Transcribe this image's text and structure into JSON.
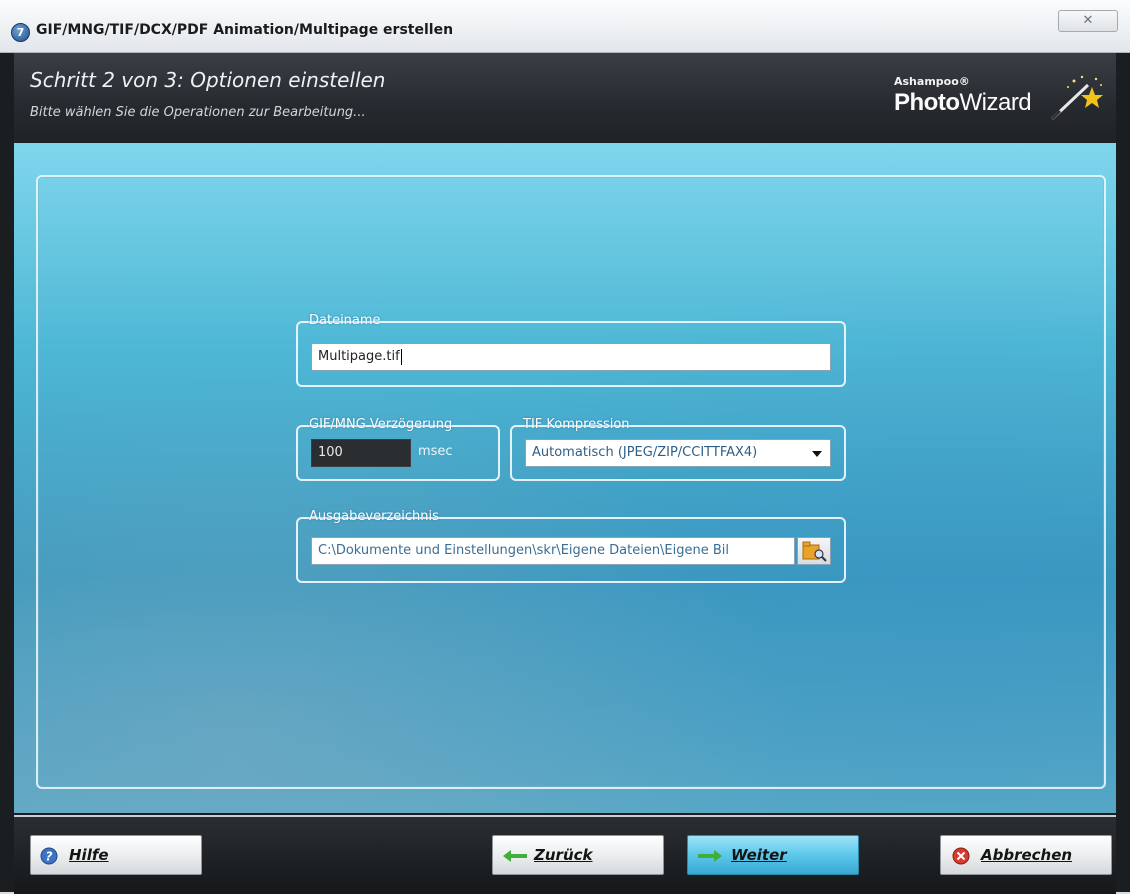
{
  "window": {
    "title": "GIF/MNG/TIF/DCX/PDF Animation/Multipage erstellen",
    "app_icon_glyph": "7",
    "close_label": "✕"
  },
  "header": {
    "step_title": "Schritt 2 von 3: Optionen einstellen",
    "step_subtitle": "Bitte wählen Sie die Operationen zur Bearbeitung...",
    "brand_small": "Ashampoo®",
    "brand_name_bold": "Photo",
    "brand_name_regular": "Wizard"
  },
  "form": {
    "filename": {
      "label": "Dateiname",
      "value": "Multipage.tif"
    },
    "delay": {
      "label": "GIF/MNG Verzögerung",
      "value": "100",
      "unit": "msec"
    },
    "compression": {
      "label": "TIF Kompression",
      "selected": "Automatisch (JPEG/ZIP/CCITTFAX4)"
    },
    "output_dir": {
      "label": "Ausgabeverzeichnis",
      "value": "C:\\Dokumente und Einstellungen\\skr\\Eigene Dateien\\Eigene Bil"
    }
  },
  "buttons": {
    "help": "Hilfe",
    "back": "Zurück",
    "next": "Weiter",
    "cancel": "Abbrechen"
  },
  "colors": {
    "panel_accent": "#4fb8d6",
    "primary_button": "#5cc7ea",
    "cancel_icon": "#d83a2e",
    "arrow_icon": "#3fae3a"
  }
}
